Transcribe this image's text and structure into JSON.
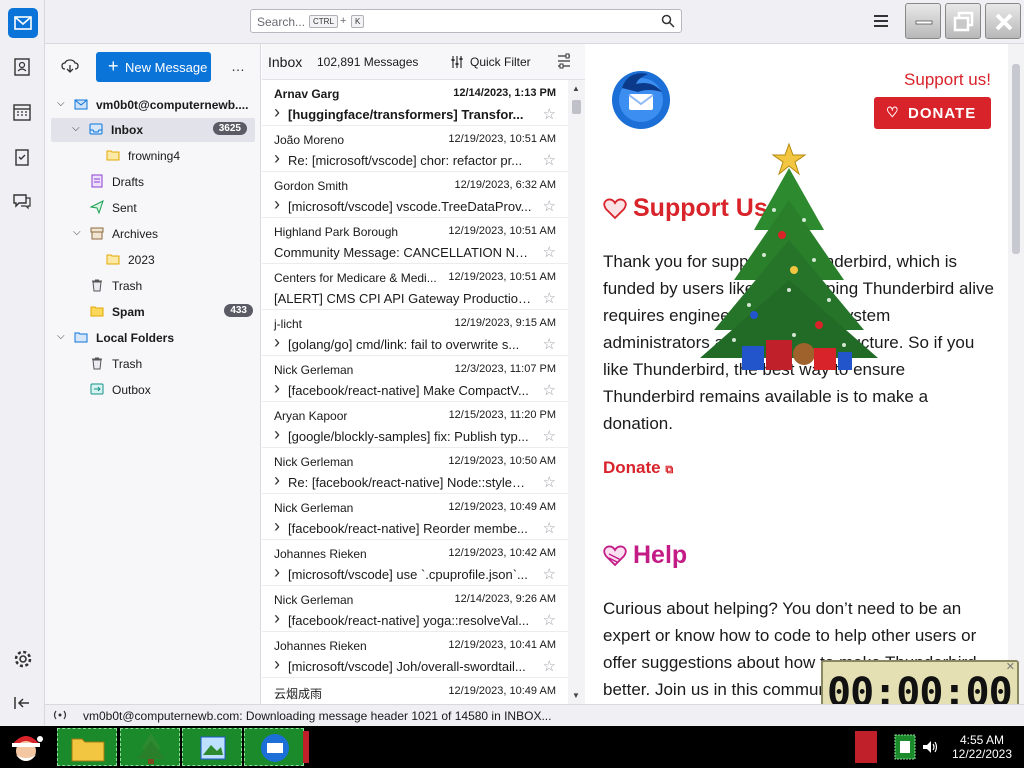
{
  "search": {
    "placeholder": "Search...",
    "key1": "CTRL",
    "plus": "+",
    "key2": "K"
  },
  "folder_pane": {
    "new_message": "New Message",
    "more": "…",
    "folders": [
      {
        "label": "vm0b0t@computernewb....",
        "bold": true
      },
      {
        "label": "Inbox",
        "badge": "3625",
        "bold": true
      },
      {
        "label": "frowning4"
      },
      {
        "label": "Drafts"
      },
      {
        "label": "Sent"
      },
      {
        "label": "Archives"
      },
      {
        "label": "2023"
      },
      {
        "label": "Trash"
      },
      {
        "label": "Spam",
        "badge": "433",
        "bold": true
      },
      {
        "label": "Local Folders",
        "bold": true
      },
      {
        "label": "Trash"
      },
      {
        "label": "Outbox"
      }
    ]
  },
  "message_list": {
    "folder": "Inbox",
    "count": "102,891 Messages",
    "quick_filter": "Quick Filter",
    "rows": [
      {
        "from": "Arnav Garg",
        "date": "12/14/2023, 1:13 PM",
        "subject": "[huggingface/transformers] Transfor...",
        "thread": true,
        "bold": true
      },
      {
        "from": "João Moreno",
        "date": "12/19/2023, 10:51 AM",
        "subject": "Re: [microsoft/vscode] chor: refactor pr...",
        "thread": true
      },
      {
        "from": "Gordon Smith",
        "date": "12/19/2023, 6:32 AM",
        "subject": "[microsoft/vscode] vscode.TreeDataProv...",
        "thread": true
      },
      {
        "from": "Highland Park Borough",
        "date": "12/19/2023, 10:51 AM",
        "subject": "Community Message: CANCELLATION Noti...",
        "thread": false
      },
      {
        "from": "Centers for Medicare & Medi...",
        "date": "12/19/2023, 10:51 AM",
        "subject": "[ALERT] CMS CPI API Gateway Production -...",
        "thread": false
      },
      {
        "from": "j-licht",
        "date": "12/19/2023, 9:15 AM",
        "subject": "[golang/go] cmd/link: fail to overwrite s...",
        "thread": true
      },
      {
        "from": "Nick Gerleman",
        "date": "12/3/2023, 11:07 PM",
        "subject": "[facebook/react-native] Make CompactV...",
        "thread": true
      },
      {
        "from": "Aryan Kapoor",
        "date": "12/15/2023, 11:20 PM",
        "subject": "[google/blockly-samples] fix: Publish typ...",
        "thread": true
      },
      {
        "from": "Nick Gerleman",
        "date": "12/19/2023, 10:50 AM",
        "subject": "Re: [facebook/react-native] Node::styleD...",
        "thread": true
      },
      {
        "from": "Nick Gerleman",
        "date": "12/19/2023, 10:49 AM",
        "subject": "[facebook/react-native] Reorder membe...",
        "thread": true
      },
      {
        "from": "Johannes Rieken",
        "date": "12/19/2023, 10:42 AM",
        "subject": "[microsoft/vscode] use `.cpuprofile.json`...",
        "thread": true
      },
      {
        "from": "Nick Gerleman",
        "date": "12/14/2023, 9:26 AM",
        "subject": "[facebook/react-native] yoga::resolveVal...",
        "thread": true
      },
      {
        "from": "Johannes Rieken",
        "date": "12/19/2023, 10:41 AM",
        "subject": "[microsoft/vscode] Joh/overall-swordtail...",
        "thread": true
      },
      {
        "from": "云烟成雨",
        "date": "12/19/2023, 10:49 AM",
        "subject": "",
        "thread": false
      }
    ]
  },
  "message_pane": {
    "support_link": "Support us!",
    "donate_button": "DONATE",
    "support_heading": "Support Us",
    "support_text": "Thank you for supporting Thunderbird, which is funded by users like you! Keeping Thunderbird alive requires engineers, designers, system administrators and server infrastructure. So if you like Thunderbird, the best way to ensure Thunderbird remains available is to make a donation.",
    "donate_link": "Donate",
    "help_heading": "Help",
    "help_text": "Curious about helping? You don’t need to be an expert or know how to code to help other users or offer suggestions about how to make Thunderbird better. Join us in this community experience! Join us in this effort."
  },
  "status_bar": {
    "text": "vm0b0t@computernewb.com: Downloading message header 1021 of 14580 in INBOX..."
  },
  "clock_widget": {
    "time": "00:00:00"
  },
  "taskbar": {
    "time": "4:55 AM",
    "date": "12/22/2023"
  },
  "colors": {
    "accent": "#0a74d9",
    "donate": "#d8232a",
    "help": "#c31c87"
  }
}
